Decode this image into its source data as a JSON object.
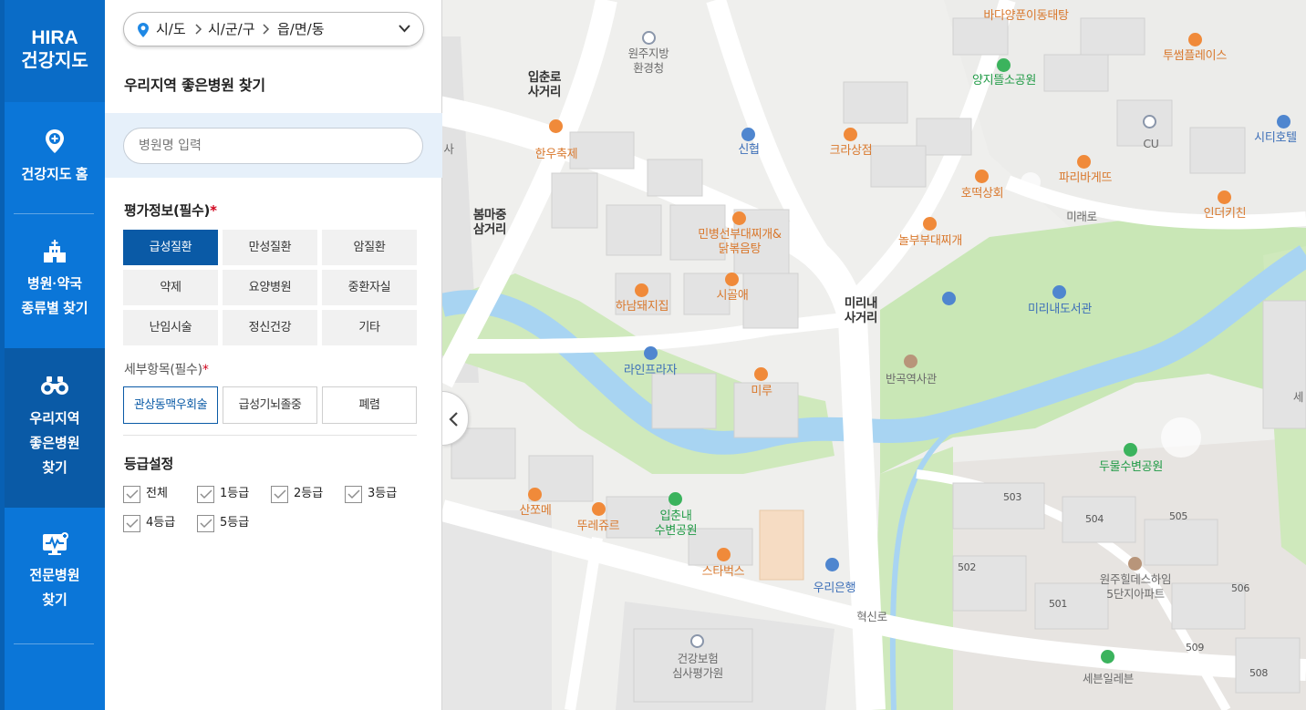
{
  "logo": {
    "line1": "HIRA",
    "line2": "건강지도"
  },
  "nav": {
    "items": [
      {
        "label": "건강지도 홈",
        "icon": "map-pin-plus-icon"
      },
      {
        "label": "병원·약국\n종류별 찾기",
        "icon": "hospital-building-icon"
      },
      {
        "label": "우리지역\n좋은병원\n찾기",
        "icon": "binoculars-icon",
        "active": true
      },
      {
        "label": "전문병원\n찾기",
        "icon": "monitor-heartbeat-icon"
      }
    ]
  },
  "region": {
    "sido": "시/도",
    "sigungu": "시/군/구",
    "dong": "읍/면/동"
  },
  "panel": {
    "title": "우리지역 좋은병원 찾기"
  },
  "search": {
    "placeholder": "병원명 입력",
    "value": ""
  },
  "evaluation": {
    "title": "평가정보(필수)",
    "required_mark": "*",
    "options": [
      "급성질환",
      "만성질환",
      "암질환",
      "약제",
      "요양병원",
      "중환자실",
      "난임시술",
      "정신건강",
      "기타"
    ],
    "selected": "급성질환"
  },
  "detail": {
    "title": "세부항목(필수)",
    "required_mark": "*",
    "options": [
      "관상동맥우회술",
      "급성기뇌졸중",
      "폐렴"
    ],
    "selected": "관상동맥우회술"
  },
  "grade": {
    "title": "등급설정",
    "options": [
      "전체",
      "1등급",
      "2등급",
      "3등급",
      "4등급",
      "5등급"
    ]
  },
  "map": {
    "labels": {
      "bada": "바다양푼이동태탕",
      "env": "원주지방\n환경청",
      "twosome": "투썸플레이스",
      "yangji": "양지뜰소공원",
      "ipchun_cross": "입춘로\n사거리",
      "sa": "사",
      "hanwoo": "한우축제",
      "shinhyup": "신협",
      "krasang": "크라상점",
      "cu": "CU",
      "city_hotel": "시티호텔",
      "paris": "파리바게뜨",
      "hotteok": "호떡상회",
      "mirae_ro": "미래로",
      "inder": "인더키친",
      "bommajung": "봄마중\n삼거리",
      "minbyungsun": "민병선부대찌개&\n닭볶음탕",
      "nolboo": "놀부부대찌개",
      "sigoli": "시골애",
      "hanam": "하남돼지집",
      "mirinae_cross": "미리내\n사거리",
      "mirinae_lib": "미리내도서관",
      "line_plaza": "라인프라자",
      "bangok": "반곡역사관",
      "miru": "미루",
      "se": "세",
      "dumul": "두물수변공원",
      "sanjjome": "산쪼메",
      "ttore": "뚜레쥬르",
      "ipchunnae": "입춘내\n수변공원",
      "starbucks": "스타벅스",
      "woori": "우리은행",
      "hyeoksin": "혁신로",
      "hillstate": "원주힐데스하임\n5단지아파트",
      "hira_bldg": "건강보험\n심사평가원",
      "seven": "세븐일레븐",
      "b503": "503",
      "b504": "504",
      "b505": "505",
      "b502": "502",
      "b501": "501",
      "b506": "506",
      "b509": "509",
      "b508": "508"
    }
  },
  "colors": {
    "nav_blue": "#0b76d8",
    "nav_active": "#0a5aa6",
    "accent": "#0a5aa6",
    "required": "#d0021b"
  }
}
